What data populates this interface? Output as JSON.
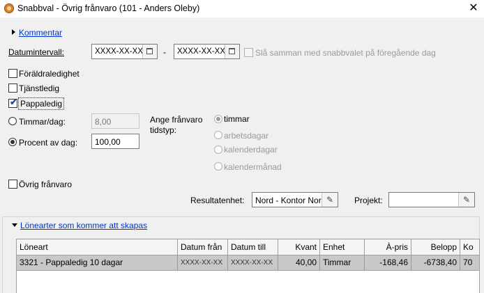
{
  "window": {
    "title": "Snabbval - Övrig frånvaro (101 - Anders Oleby)",
    "close_glyph": "✕"
  },
  "comment_section": {
    "label": "Kommentar"
  },
  "date_interval": {
    "label": "Datumintervall:",
    "from_value": "XXXX-XX-XX",
    "separator": "-",
    "to_value": "XXXX-XX-XX",
    "merge_label": "Slå samman med snabbvalet på föregående dag",
    "merge_checked": false
  },
  "leave_types": [
    {
      "label": "Föräldraledighet",
      "checked": false
    },
    {
      "label": "Tjänstledig",
      "checked": false
    },
    {
      "label": "Pappaledig",
      "checked": true
    }
  ],
  "hours_per_day": {
    "label": "Timmar/dag:",
    "value": "8,00",
    "selected": false
  },
  "percent_per_day": {
    "label": "Procent av dag:",
    "value": "100,00",
    "selected": true
  },
  "absence_type": {
    "label_line1": "Ange frånvaro",
    "label_line2": "tidstyp:",
    "options": [
      {
        "label": "timmar",
        "selected": true
      },
      {
        "label": "arbetsdagar",
        "selected": false
      },
      {
        "label": "kalenderdagar",
        "selected": false
      },
      {
        "label": "kalendermånad",
        "selected": false
      }
    ]
  },
  "other_absence": {
    "label": "Övrig frånvaro",
    "checked": false
  },
  "result_unit": {
    "label": "Resultatenhet:",
    "value": "Nord - Kontor Nor"
  },
  "project": {
    "label": "Projekt:",
    "value": ""
  },
  "salary_types_section": {
    "label": "Lönearter som kommer att skapas",
    "columns": [
      "Löneart",
      "Datum från",
      "Datum till",
      "Kvant",
      "Enhet",
      "À-pris",
      "Belopp",
      "Ko"
    ],
    "rows": [
      {
        "loneart": "3321 - Pappaledig 10 dagar",
        "datum_fran": "XXXX-XX-XX",
        "datum_till": "XXXX-XX-XX",
        "kvant": "40,00",
        "enhet": "Timmar",
        "a_pris": "-168,46",
        "belopp": "-6738,40",
        "ko": "70"
      }
    ]
  },
  "colors": {
    "link": "#0033cc",
    "selected_row": "#c8c8c8",
    "background": "#f0f0f0"
  }
}
